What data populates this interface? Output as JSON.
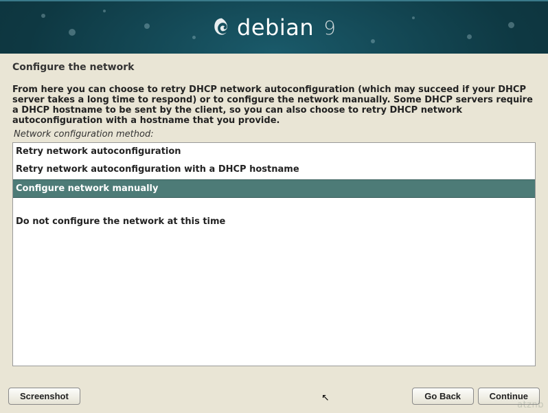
{
  "header": {
    "brand_text": "debian",
    "brand_version": "9"
  },
  "page": {
    "title": "Configure the network",
    "description": "From here you can choose to retry DHCP network autoconfiguration (which may succeed if your DHCP server takes a long time to respond) or to configure the network manually. Some DHCP servers require a DHCP hostname to be sent by the client, so you can also choose to retry DHCP network autoconfiguration with a hostname that you provide.",
    "field_label": "Network configuration method:"
  },
  "options": {
    "items": [
      {
        "label": "Retry network autoconfiguration",
        "selected": false
      },
      {
        "label": "Retry network autoconfiguration with a DHCP hostname",
        "selected": false
      },
      {
        "label": "Configure network manually",
        "selected": true
      },
      {
        "label": "Do not configure the network at this time",
        "selected": false,
        "spacer_before": true
      }
    ]
  },
  "buttons": {
    "screenshot": "Screenshot",
    "go_back": "Go Back",
    "continue": "Continue"
  },
  "watermark": "atznb"
}
